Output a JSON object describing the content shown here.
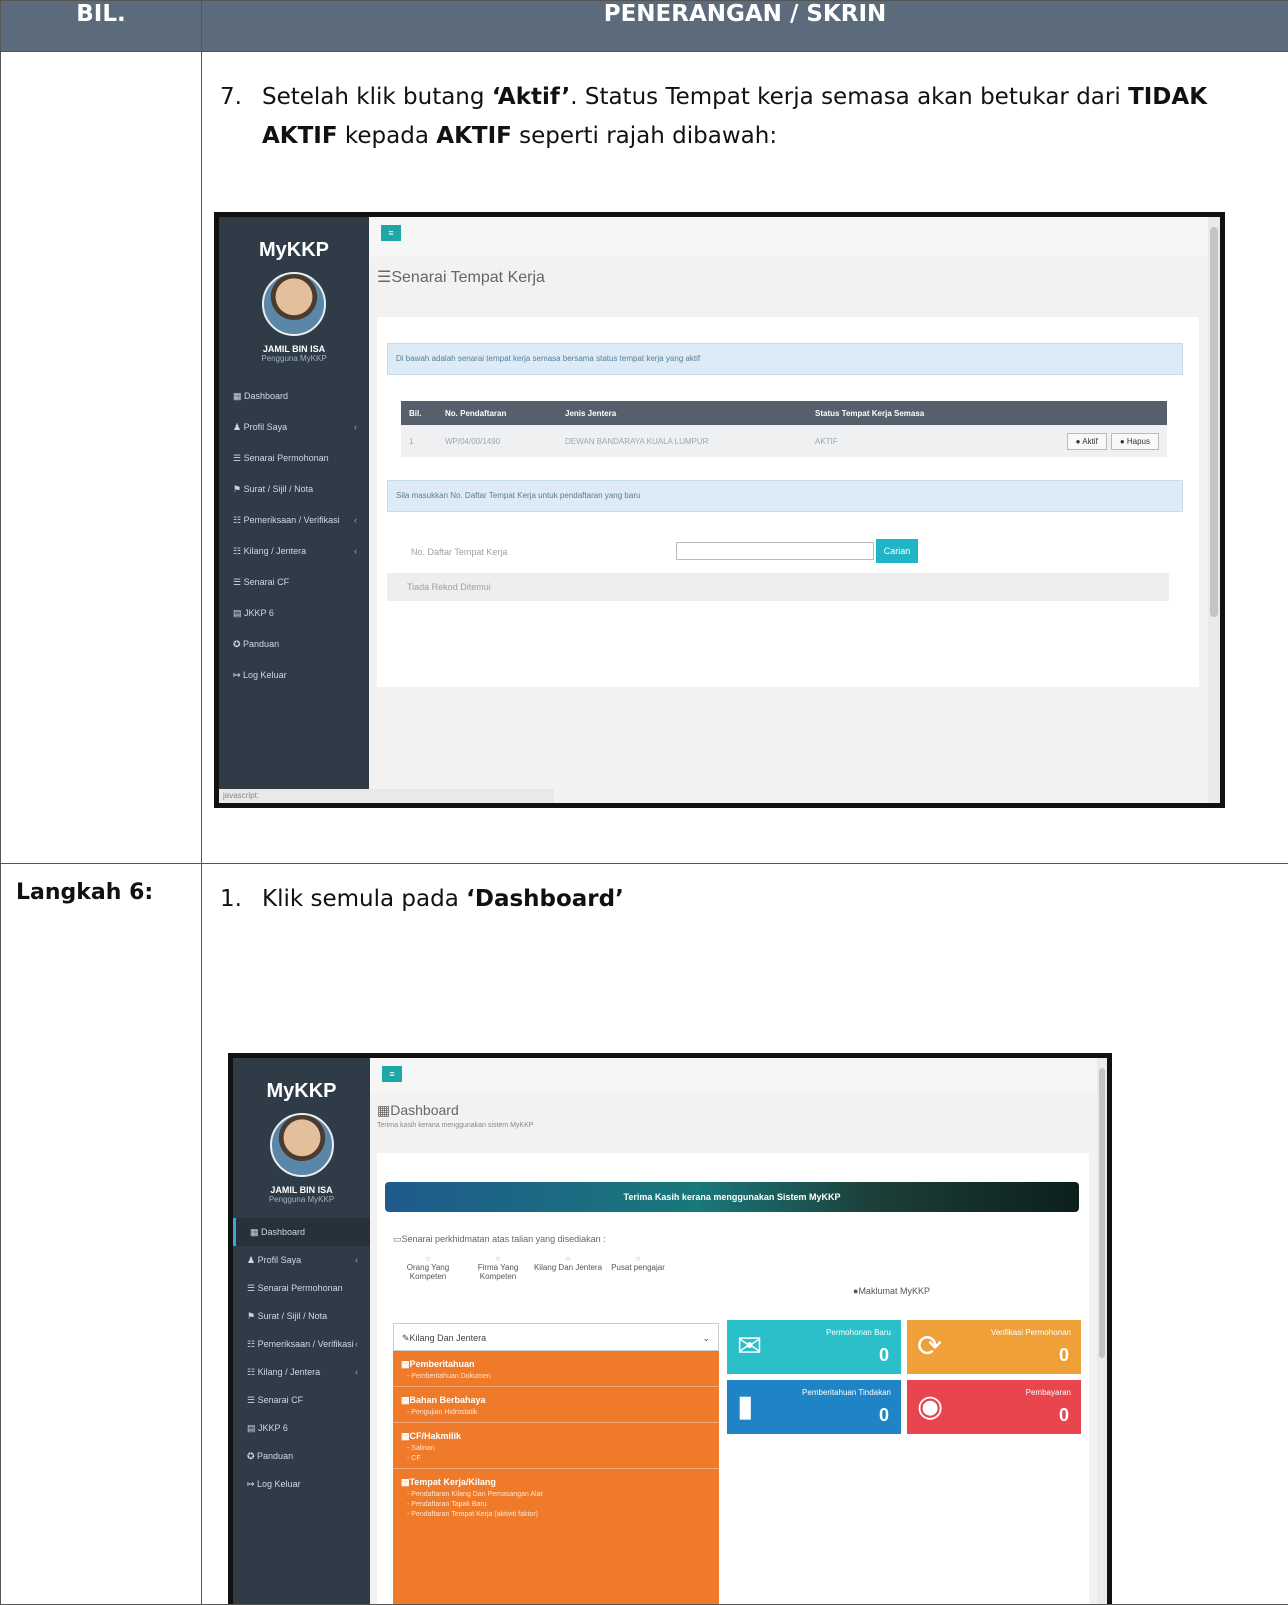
{
  "table": {
    "col1_header": "BIL.",
    "col2_header": "PENERANGAN / SKRIN"
  },
  "row1": {
    "num": "7.",
    "text_a": "Setelah klik butang ",
    "bold_a": "‘Aktif’",
    "text_b": ". Status Tempat kerja semasa akan betukar dari ",
    "bold_b": "TIDAK AKTIF",
    "text_c": " kepada ",
    "bold_c": "AKTIF",
    "text_d": " seperti rajah dibawah:"
  },
  "row2": {
    "label": "Langkah 6:",
    "num": "1.",
    "text_a": "Klik semula pada ",
    "bold_a": "‘Dashboard’"
  },
  "app": {
    "brand": "MyKKP",
    "user_name": "JAMIL BIN ISA",
    "user_role": "Pengguna MyKKP",
    "menu": [
      "Dashboard",
      "Profil Saya",
      "Senarai Permohonan",
      "Surat / Sijil / Nota",
      "Pemeriksaan / Verifikasi",
      "Kilang / Jentera",
      "Senarai CF",
      "JKKP 6",
      "Panduan",
      "Log Keluar"
    ],
    "menu_has_chevron": [
      false,
      true,
      false,
      false,
      true,
      true,
      false,
      false,
      false,
      false
    ]
  },
  "screen1": {
    "page_title": "Senarai Tempat Kerja",
    "info1": "Di bawah adalah senarai tempat kerja semasa bersama status tempat kerja yang aktif",
    "table_headers": [
      "Bil.",
      "No. Pendaftaran",
      "Jenis Jentera",
      "Status Tempat Kerja Semasa",
      ""
    ],
    "table_row": [
      "1",
      "WP/04/00/1490",
      "DEWAN BANDARAYA KUALA LUMPUR",
      "AKTIF"
    ],
    "btn_active": "Aktif",
    "btn_delete": "Hapus",
    "info2": "Sila masukkan No. Daftar Tempat Kerja untuk pendaftaran yang baru",
    "form_label": "No. Daftar Tempat Kerja",
    "search_button": "Carian",
    "no_record": "Tiada Rekod Ditemui",
    "status_text": "javascript:"
  },
  "screen2": {
    "page_title": "Dashboard",
    "page_subtitle": "Terima kasih kerana menggunakan sistem MyKKP",
    "banner": "Terima Kasih kerana menggunakan Sistem MyKKP",
    "services_title": "Senarai perkhidmatan atas talian yang disediakan :",
    "services": [
      "Orang Yang Kompeten",
      "Firma Yang Kompeten",
      "Kilang Dan Jentera",
      "Pusat pengajar"
    ],
    "info_title": "Maklumat MyKKP",
    "accordion": "Kilang Dan Jentera",
    "sections": [
      {
        "h": "Pemberitahuan",
        "items": [
          "Pemberitahuan Dokumen"
        ]
      },
      {
        "h": "Bahan Berbahaya",
        "items": [
          "Pengujian Hidrostatik"
        ]
      },
      {
        "h": "CF/Hakmilik",
        "items": [
          "Salinan",
          "CF"
        ]
      },
      {
        "h": "Tempat Kerja/Kilang",
        "items": [
          "Pendaftaran Kilang Dan Pemasangan Alat",
          "Pendaftaran Tapak Baru",
          "Pendaftaran Tempat Kerja (aktiviti faktor)"
        ]
      }
    ],
    "tiles": [
      {
        "title": "Permohonan Baru",
        "value": "0",
        "color": "#2bbfc9"
      },
      {
        "title": "Verifikasi Permohonan",
        "value": "0",
        "color": "#f0a038"
      },
      {
        "title": "Pemberitahuan Tindakan",
        "value": "0",
        "color": "#1f84c6"
      },
      {
        "title": "Pembayaran",
        "value": "0",
        "color": "#e8454f"
      }
    ]
  }
}
